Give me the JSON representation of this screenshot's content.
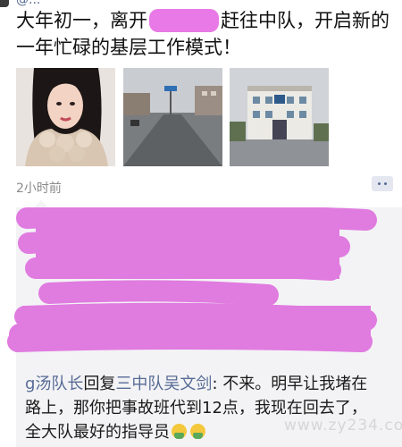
{
  "post": {
    "author_fragment": "@...",
    "text_before": "大年初一，离开",
    "text_after": "赶往中队，开启新的一年忙碌的基层工作模式！",
    "time": "2小时前"
  },
  "photos": [
    {
      "description": "portrait-woman-fur-scarf"
    },
    {
      "description": "road-to-town"
    },
    {
      "description": "station-building"
    }
  ],
  "comment": {
    "author": "g汤队长",
    "reply_word": "回复",
    "reply_to": "三中队吴文剑",
    "text": ": 不来。明早让我堵在路上，那你把事故班代到12点，我现在回去了，全大队最好的指导员"
  },
  "watermark": "www.zy234.com",
  "colors": {
    "name_link": "#576b95",
    "redaction": "#e879e6",
    "comment_bg": "#f3f3f5"
  }
}
